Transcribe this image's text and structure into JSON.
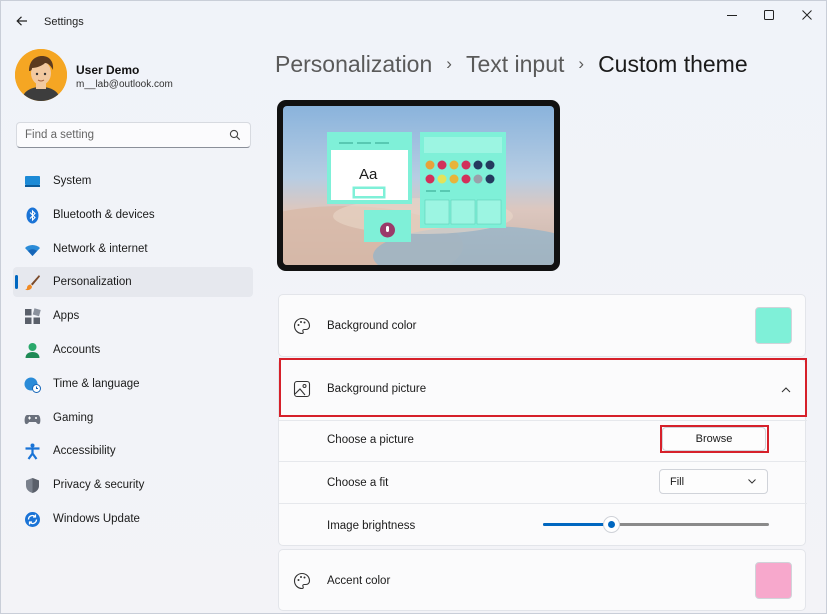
{
  "app": {
    "title": "Settings"
  },
  "window": {
    "minimize": "—",
    "maximize": "☐",
    "close": "✕"
  },
  "user": {
    "name": "User Demo",
    "email": "m__lab@outlook.com"
  },
  "search": {
    "placeholder": "Find a setting"
  },
  "nav": {
    "items": [
      {
        "label": "System",
        "icon": "system-icon"
      },
      {
        "label": "Bluetooth & devices",
        "icon": "bluetooth-icon"
      },
      {
        "label": "Network & internet",
        "icon": "wifi-icon"
      },
      {
        "label": "Personalization",
        "icon": "brush-icon",
        "active": true
      },
      {
        "label": "Apps",
        "icon": "apps-icon"
      },
      {
        "label": "Accounts",
        "icon": "accounts-icon"
      },
      {
        "label": "Time & language",
        "icon": "globe-clock-icon"
      },
      {
        "label": "Gaming",
        "icon": "gamepad-icon"
      },
      {
        "label": "Accessibility",
        "icon": "accessibility-icon"
      },
      {
        "label": "Privacy & security",
        "icon": "shield-icon"
      },
      {
        "label": "Windows Update",
        "icon": "update-icon"
      }
    ]
  },
  "breadcrumb": {
    "items": [
      "Personalization",
      "Text input"
    ],
    "current": "Custom theme",
    "separator": "›"
  },
  "preview": {
    "sample_text": "Aa"
  },
  "settings": {
    "background_color": {
      "label": "Background color",
      "value": "#7ff0d8"
    },
    "background_picture": {
      "label": "Background picture",
      "expanded": true
    },
    "choose_picture": {
      "label": "Choose a picture",
      "button": "Browse"
    },
    "choose_fit": {
      "label": "Choose a fit",
      "value": "Fill"
    },
    "image_brightness": {
      "label": "Image brightness",
      "value_fraction": 0.3
    },
    "accent_color": {
      "label": "Accent color",
      "value": "#f7a8cc"
    }
  },
  "colors": {
    "accent": "#0067c0",
    "highlight": "#d6202a"
  }
}
